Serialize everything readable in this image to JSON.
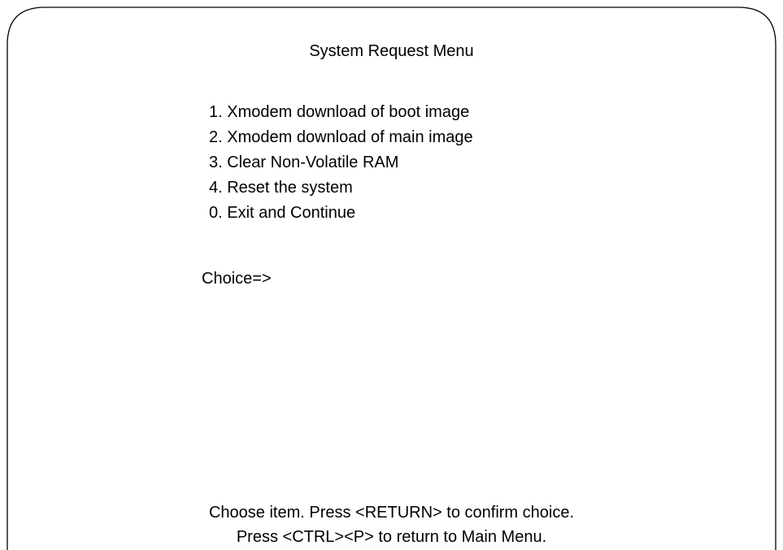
{
  "screen": {
    "title": "System Request Menu",
    "menu_items": [
      {
        "label": "1. Xmodem download of boot image"
      },
      {
        "label": "2. Xmodem download of main image"
      },
      {
        "label": "3. Clear Non-Volatile RAM"
      },
      {
        "label": "4. Reset the system"
      },
      {
        "label": "0. Exit and Continue"
      }
    ],
    "choice_prompt": "Choice=>",
    "choice_value": "",
    "footer_line1": "Choose item. Press <RETURN> to confirm choice.",
    "footer_line2": "Press <CTRL><P> to return to Main Menu."
  },
  "colors": {
    "background": "#ffffff",
    "text": "#000000",
    "frame": "#000000"
  }
}
